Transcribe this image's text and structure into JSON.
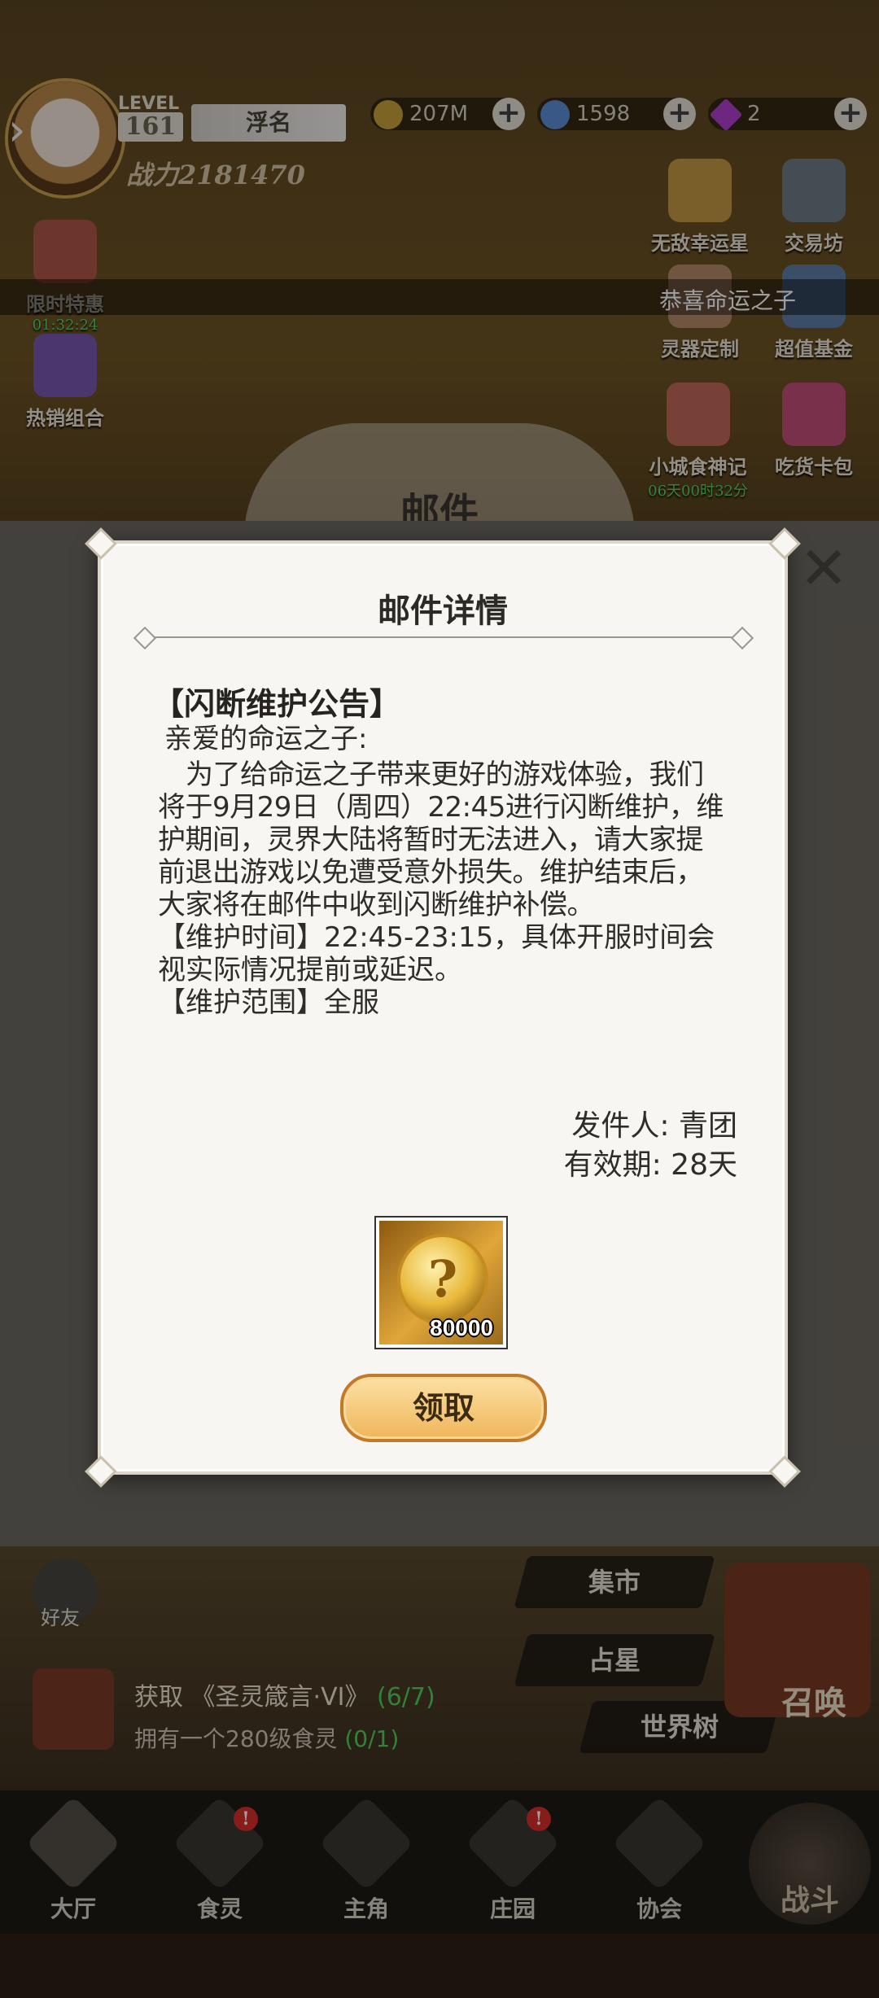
{
  "hud": {
    "level_label": "LEVEL",
    "level": "161",
    "player_name": "浮名",
    "power": "战力2181470",
    "gold": "207M",
    "crystal": "1598",
    "diamond": "2",
    "plus": "+"
  },
  "side_left": [
    {
      "label": "限时特惠",
      "timer": "01:32:24"
    },
    {
      "label": "热销组合",
      "timer": ""
    }
  ],
  "side_right": [
    {
      "label": "无敌幸运星",
      "timer": ""
    },
    {
      "label": "交易坊",
      "timer": ""
    },
    {
      "label": "灵器定制",
      "timer": ""
    },
    {
      "label": "超值基金",
      "timer": ""
    },
    {
      "label": "小城食神记",
      "timer": "06天00时32分"
    },
    {
      "label": "吃货卡包",
      "timer": ""
    }
  ],
  "ticker": "恭喜命运之子",
  "scene_title": "邮件",
  "dialog": {
    "title": "邮件详情",
    "subject": "【闪断维护公告】",
    "greeting": "亲爱的命运之子:",
    "para1": "为了给命运之子带来更好的游戏体验，我们将于9月29日（周四）22:45进行闪断维护，维护期间，灵界大陆将暂时无法进入，请大家提前退出游戏以免遭受意外损失。维护结束后，大家将在邮件中收到闪断维护补偿。",
    "para2": "【维护时间】22:45-23:15，具体开服时间会视实际情况提前或延迟。",
    "para3": "【维护范围】全服",
    "sender": "发件人: 青团",
    "validity": "有效期: 28天",
    "reward_qty": "80000",
    "claim_label": "领取",
    "close": "✕"
  },
  "lower": {
    "friend": "好友",
    "menu": [
      "集市",
      "占星",
      "世界树"
    ],
    "summon": "召唤",
    "quest_prefix": "获取",
    "quest_name": "《圣灵箴言·VI》",
    "quest_progress": "(6/7)",
    "quest_sub": "拥有一个280级食灵",
    "quest_sub_progress": "(0/1)"
  },
  "nav": [
    "大厅",
    "食灵",
    "主角",
    "庄园",
    "协会"
  ],
  "fight": "战斗",
  "colors": {
    "accent_gold": "#f0b55a",
    "progress_green": "#4fd15b",
    "badge_red": "#d9302a"
  }
}
